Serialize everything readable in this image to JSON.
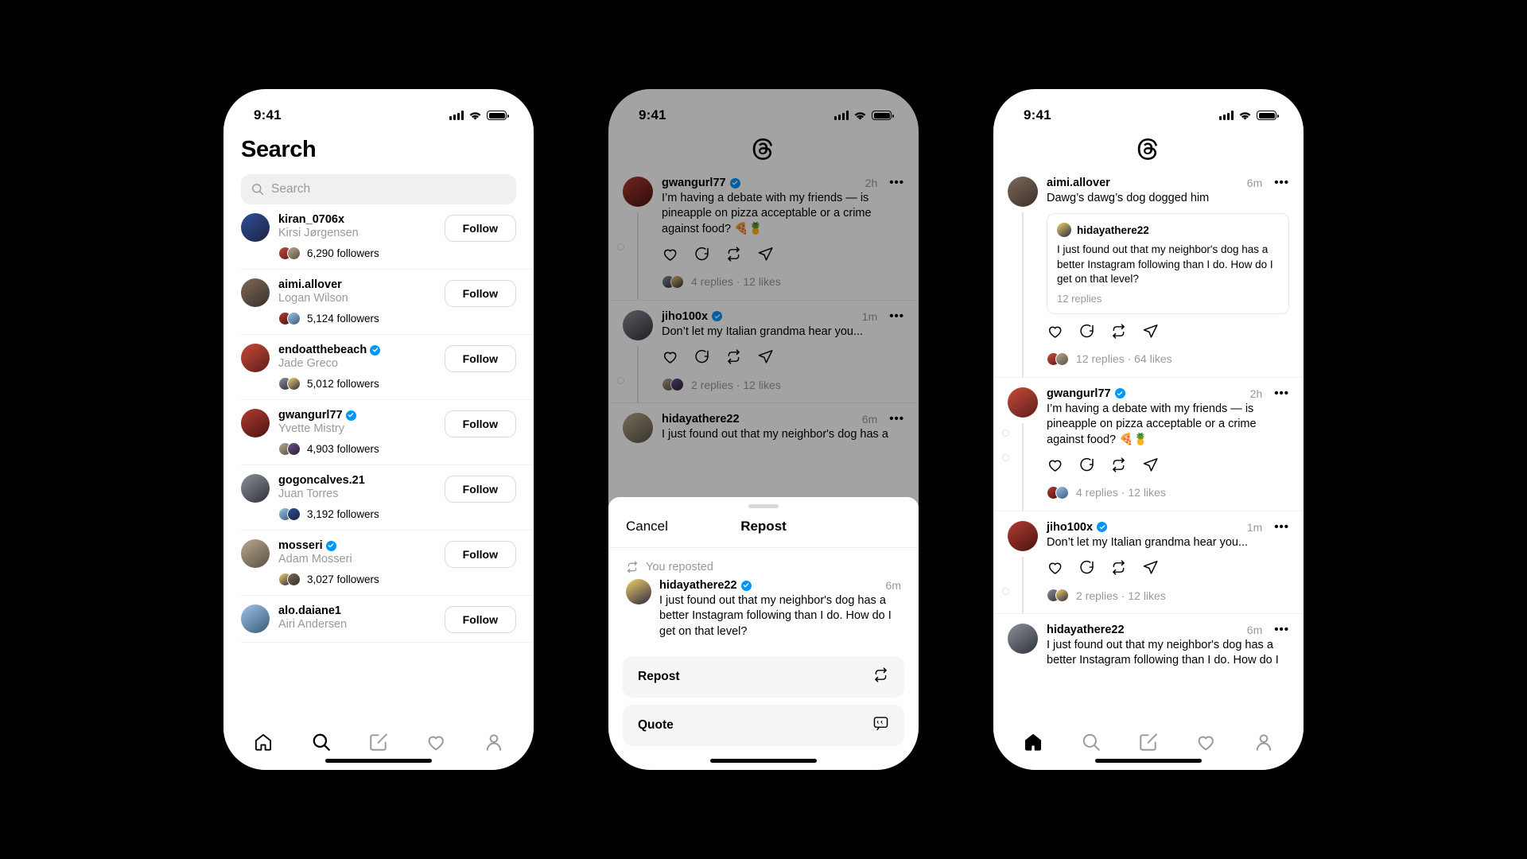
{
  "status_bar": {
    "time": "9:41",
    "signal_icon": "cellular-bars-icon",
    "wifi_icon": "wifi-icon",
    "battery_icon": "battery-icon"
  },
  "phone1": {
    "title": "Search",
    "search": {
      "placeholder": "Search",
      "value": "",
      "icon": "search-icon"
    },
    "users": [
      {
        "username": "kiran_0706x",
        "name": "Kirsi Jørgensen",
        "followers": "6,290 followers",
        "verified": false,
        "follow_label": "Follow"
      },
      {
        "username": "aimi.allover",
        "name": "Logan Wilson",
        "followers": "5,124 followers",
        "verified": false,
        "follow_label": "Follow"
      },
      {
        "username": "endoatthebeach",
        "name": "Jade Greco",
        "followers": "5,012 followers",
        "verified": true,
        "follow_label": "Follow"
      },
      {
        "username": "gwangurl77",
        "name": "Yvette Mistry",
        "followers": "4,903 followers",
        "verified": true,
        "follow_label": "Follow"
      },
      {
        "username": "gogoncalves.21",
        "name": "Juan Torres",
        "followers": "3,192 followers",
        "verified": false,
        "follow_label": "Follow"
      },
      {
        "username": "mosseri",
        "name": "Adam Mosseri",
        "followers": "3,027 followers",
        "verified": true,
        "follow_label": "Follow"
      },
      {
        "username": "alo.daiane1",
        "name": "Airi Andersen",
        "followers": "",
        "verified": false,
        "follow_label": "Follow"
      }
    ],
    "tabs": [
      {
        "name": "home-tab",
        "icon": "home-icon",
        "active": false
      },
      {
        "name": "search-tab",
        "icon": "search-icon",
        "active": true
      },
      {
        "name": "compose-tab",
        "icon": "compose-icon",
        "active": false
      },
      {
        "name": "activity-tab",
        "icon": "heart-icon",
        "active": false
      },
      {
        "name": "profile-tab",
        "icon": "person-icon",
        "active": false
      }
    ]
  },
  "phone2": {
    "logo": "threads-logo-icon",
    "posts": [
      {
        "username": "gwangurl77",
        "verified": true,
        "time": "2h",
        "text": "I’m having a debate with my friends — is pineapple on pizza acceptable or a crime against food? 🍕🍍",
        "meta": "4 replies · 12 likes"
      },
      {
        "username": "jiho100x",
        "verified": true,
        "time": "1m",
        "text": "Don’t let my Italian grandma hear you...",
        "meta": "2 replies · 12 likes"
      },
      {
        "username": "hidayathere22",
        "verified": false,
        "time": "6m",
        "text": "I just found out that my neighbor's dog has a",
        "meta": ""
      }
    ],
    "sheet": {
      "cancel_label": "Cancel",
      "title": "Repost",
      "reposted_label": "You reposted",
      "reposted_icon": "repost-icon",
      "post": {
        "username": "hidayathere22",
        "verified": true,
        "time": "6m",
        "text": "I just found out that my neighbor's dog has a better Instagram following than I do. How do I get on that level?"
      },
      "options": [
        {
          "label": "Repost",
          "icon": "repost-icon"
        },
        {
          "label": "Quote",
          "icon": "quote-icon"
        }
      ]
    }
  },
  "phone3": {
    "logo": "threads-logo-icon",
    "posts": [
      {
        "username": "aimi.allover",
        "verified": false,
        "time": "6m",
        "text": "Dawg’s dawg’s dog dogged him",
        "quote": {
          "username": "hidayathere22",
          "text": "I just found out that my neighbor's dog has a better Instagram following than I do. How do I get on that level?",
          "replies": "12 replies"
        },
        "meta": "12 replies · 64 likes"
      },
      {
        "username": "gwangurl77",
        "verified": true,
        "time": "2h",
        "text": "I’m having a debate with my friends — is pineapple on pizza acceptable or a crime against food? 🍕🍍",
        "meta": "4 replies · 12 likes"
      },
      {
        "username": "jiho100x",
        "verified": true,
        "time": "1m",
        "text": "Don’t let my Italian grandma hear you...",
        "meta": "2 replies · 12 likes"
      },
      {
        "username": "hidayathere22",
        "verified": false,
        "time": "6m",
        "text": "I just found out that my neighbor's dog has a better Instagram following than I do. How do I",
        "meta": ""
      }
    ],
    "tabs": [
      {
        "name": "home-tab",
        "icon": "home-icon",
        "active": true
      },
      {
        "name": "search-tab",
        "icon": "search-icon",
        "active": false
      },
      {
        "name": "compose-tab",
        "icon": "compose-icon",
        "active": false
      },
      {
        "name": "activity-tab",
        "icon": "heart-icon",
        "active": false
      },
      {
        "name": "profile-tab",
        "icon": "person-icon",
        "active": false
      }
    ]
  },
  "colors": {
    "background": "#000000",
    "verified_blue": "#0095f6",
    "surface": "#ffffff",
    "muted_text": "#999999",
    "chip": "#f0f0f0"
  }
}
